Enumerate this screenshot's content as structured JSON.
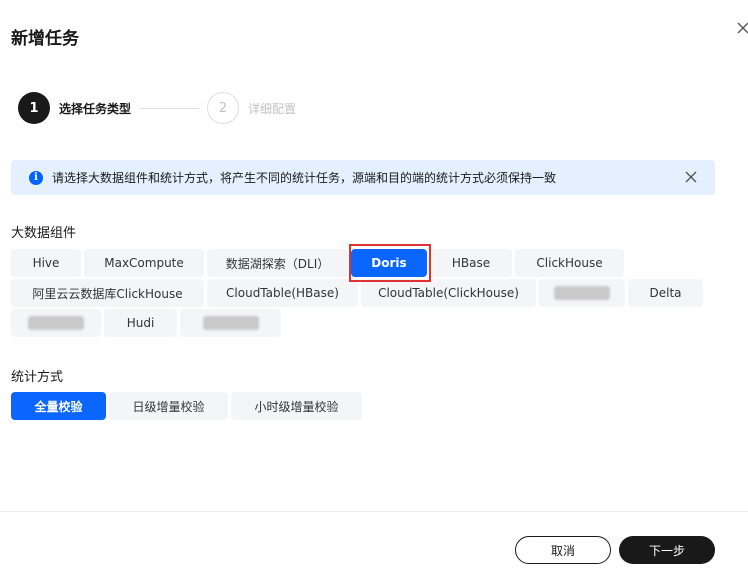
{
  "dialog": {
    "title": "新增任务"
  },
  "steps": [
    {
      "number": "1",
      "label": "选择任务类型"
    },
    {
      "number": "2",
      "label": "详细配置"
    }
  ],
  "alert": {
    "text": "请选择大数据组件和统计方式，将产生不同的统计任务，源端和目的端的统计方式必须保持一致"
  },
  "components": {
    "label": "大数据组件",
    "items": [
      {
        "label": "Hive"
      },
      {
        "label": "MaxCompute"
      },
      {
        "label": "数据湖探索（DLI）"
      },
      {
        "label": "Doris"
      },
      {
        "label": "HBase"
      },
      {
        "label": "ClickHouse"
      },
      {
        "label": "阿里云云数据库ClickHouse"
      },
      {
        "label": "CloudTable(HBase)"
      },
      {
        "label": "CloudTable(ClickHouse)"
      },
      {
        "label": "Delta"
      },
      {
        "label": "Hudi"
      }
    ],
    "selected": "Doris"
  },
  "method": {
    "label": "统计方式",
    "items": [
      {
        "label": "全量校验"
      },
      {
        "label": "日级增量校验"
      },
      {
        "label": "小时级增量校验"
      }
    ],
    "selected": "全量校验"
  },
  "footer": {
    "cancel_label": "取消",
    "next_label": "下一步"
  },
  "colors": {
    "primary": "#0a66ff",
    "dark": "#191919",
    "alert_bg": "#e5f0ff",
    "highlight": "#e03233"
  }
}
